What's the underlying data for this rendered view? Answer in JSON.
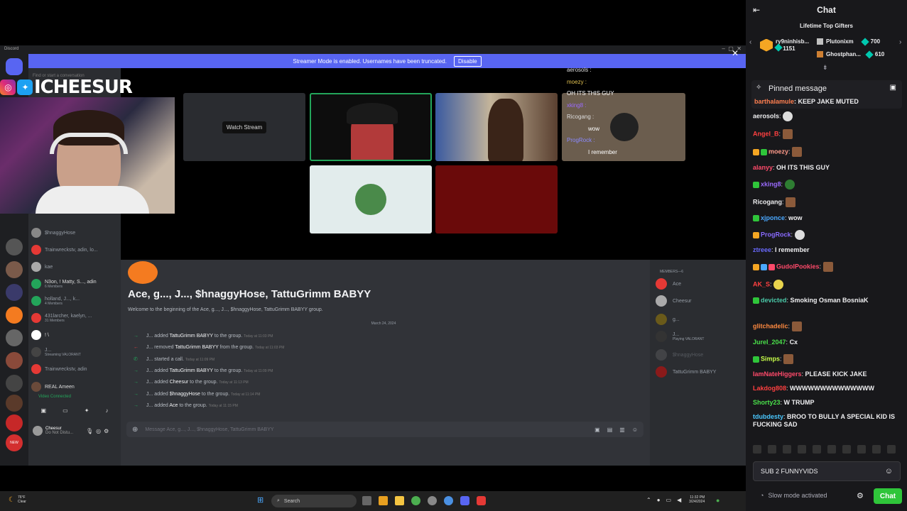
{
  "discord": {
    "app_label": "Discord",
    "banner_text": "Streamer Mode is enabled. Usernames have been truncated.",
    "banner_button": "Disable",
    "search_placeholder": "Find or start a conversation",
    "watch_stream": "Watch Stream",
    "overlay_chat": [
      {
        "user": "aerosols :",
        "msg": ""
      },
      {
        "user": "moezy :",
        "msg": ""
      },
      {
        "user": "",
        "msg": "OH ITS THIS GUY"
      },
      {
        "user": "xking8 :",
        "msg": ""
      },
      {
        "user": "Ricogang :",
        "msg": ""
      },
      {
        "user": "",
        "msg": "wow"
      },
      {
        "user": "ProgRock :",
        "msg": ""
      },
      {
        "user": "",
        "msg": "I remember"
      }
    ],
    "dm_items": [
      {
        "name": "$hnaggyHose",
        "sub": ""
      },
      {
        "name": "Trainwreckstv, adin, lo...",
        "sub": ""
      },
      {
        "name": "kae",
        "sub": ""
      },
      {
        "name": "N3on, ! Matty, S..., adin",
        "sub": "6 Members"
      },
      {
        "name": "holland, J..., k...",
        "sub": "4 Members"
      },
      {
        "name": "431larcher, kaelyn, ...",
        "sub": "31 Members"
      },
      {
        "name": "! \\",
        "sub": ""
      },
      {
        "name": "J...",
        "sub": "Streaming VALORANT"
      },
      {
        "name": "Trainwreckstv, adin",
        "sub": ""
      },
      {
        "name": "REAL Ameen",
        "sub": ""
      }
    ],
    "video_connected": "Video Connected",
    "user_name": "Cheesur",
    "user_status": "Do Not Distu...",
    "group_title": "Ace, g..., J..., $hnaggyHose, TattuGrimm BABYY",
    "group_welcome": "Welcome to the beginning of the Ace, g..., J..., $hnaggyHose, TattuGrimm BABYY group.",
    "date_divider": "March 24, 2024",
    "messages": [
      {
        "actor": "J...",
        "action": "added",
        "target": "TattuGrimm BABYY",
        "rest": "to the group.",
        "time": "Today at 11:03 PM"
      },
      {
        "actor": "J...",
        "action": "removed",
        "target": "TattuGrimm BABYY",
        "rest": "from the group.",
        "time": "Today at 11:03 PM"
      },
      {
        "actor": "J...",
        "action": "started a call.",
        "target": "",
        "rest": "",
        "time": "Today at 11:09 PM"
      },
      {
        "actor": "J...",
        "action": "added",
        "target": "TattuGrimm BABYY",
        "rest": "to the group.",
        "time": "Today at 11:09 PM"
      },
      {
        "actor": "J...",
        "action": "added",
        "target": "Cheesur",
        "rest": "to the group.",
        "time": "Today at 11:13 PM"
      },
      {
        "actor": "J...",
        "action": "added",
        "target": "$hnaggyHose",
        "rest": "to the group.",
        "time": "Today at 11:14 PM"
      },
      {
        "actor": "J...",
        "action": "added",
        "target": "Ace",
        "rest": "to the group.",
        "time": "Today at 11:15 PM"
      }
    ],
    "message_placeholder": "Message Ace, g..., J..., $hnaggyHose, TattuGrimm BABYY",
    "members_header": "MEMBERS—6",
    "members": [
      {
        "name": "Ace",
        "sub": ""
      },
      {
        "name": "Cheesur",
        "sub": ""
      },
      {
        "name": "g...",
        "sub": ""
      },
      {
        "name": "J...",
        "sub": "Playing VALORANT"
      },
      {
        "name": "$hnaggyHose",
        "sub": ""
      },
      {
        "name": "TattuGrimm BABYY",
        "sub": ""
      }
    ]
  },
  "taskbar": {
    "weather_temp": "76°F",
    "weather_desc": "Clear",
    "search": "Search",
    "time": "11:32 PM",
    "date": "3/24/2024"
  },
  "brand": {
    "name": "ICHEESUR"
  },
  "chat": {
    "title": "Chat",
    "gifters_title": "Lifetime Top Gifters",
    "gifters": [
      {
        "name": "ry9ninhisb...",
        "count": "1151"
      },
      {
        "name": "Plutonixm",
        "count": "700"
      },
      {
        "name": "Ghostphan...",
        "count": "610"
      }
    ],
    "pinned_label": "Pinned message",
    "messages": [
      {
        "user": "barthalamule",
        "color": "#ff7f50",
        "text": "KEEP JAKE MUTED"
      },
      {
        "user": "aerosols",
        "color": "#efeff1",
        "text": ""
      },
      {
        "user": "Angel_B",
        "color": "#ff4040",
        "text": ""
      },
      {
        "user": "moezy",
        "color": "#ff9a8a",
        "text": ""
      },
      {
        "user": "alanyy",
        "color": "#ff4a6a",
        "text": "OH ITS THIS GUY"
      },
      {
        "user": "xking8",
        "color": "#9b6bff",
        "text": ""
      },
      {
        "user": "Ricogang",
        "color": "#efeff1",
        "text": ""
      },
      {
        "user": "xjponce",
        "color": "#4aa8ff",
        "text": "wow"
      },
      {
        "user": "ProgRock",
        "color": "#8a6bff",
        "text": ""
      },
      {
        "user": "ztreee",
        "color": "#6a6aff",
        "text": "I remember"
      },
      {
        "user": "GudolPookies",
        "color": "#ff4a6a",
        "text": ""
      },
      {
        "user": "AK_S",
        "color": "#ff4040",
        "text": ""
      },
      {
        "user": "devicted",
        "color": "#4ac8a8",
        "text": "Smoking Osman BosniaK"
      },
      {
        "user": "glitchadelic",
        "color": "#ff8a40",
        "text": ""
      },
      {
        "user": "Jurel_2047",
        "color": "#4ae04a",
        "text": "Cx"
      },
      {
        "user": "Simps",
        "color": "#c8ff4a",
        "text": ""
      },
      {
        "user": "IamNateHiggers",
        "color": "#ff4a6a",
        "text": "PLEASE KICK JAKE"
      },
      {
        "user": "Lakdog808",
        "color": "#ff4040",
        "text": "WWWWWWWWWWWWWW"
      },
      {
        "user": "Shorty23",
        "color": "#4ae04a",
        "text": "W TRUMP"
      },
      {
        "user": "tdubdesty",
        "color": "#4ac8ff",
        "text": "BROO TO BULLY A SPECIAL KID IS FUCKING SAD"
      }
    ],
    "input_value": "SUB 2 FUNNYVIDS",
    "slow_mode": "Slow mode activated",
    "send_button": "Chat"
  }
}
